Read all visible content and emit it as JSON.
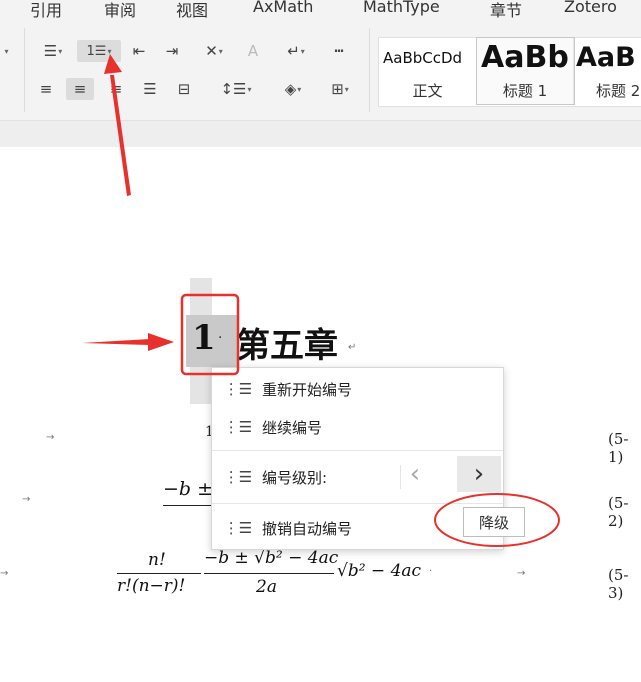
{
  "menu": [
    "引用",
    "审阅",
    "视图",
    "AxMath",
    "MathType",
    "章节",
    "Zotero"
  ],
  "ribbon": {
    "row1_icons": [
      "bullet-list-icon",
      "numbered-list-icon",
      "decrease-indent-icon",
      "increase-indent-icon",
      "chinese-layout-icon",
      "text-direction-icon",
      "line-break-icon",
      "ruler-icon"
    ],
    "row2_icons": [
      "align-left-icon",
      "align-center-icon",
      "align-right-icon",
      "justify-icon",
      "distributed-icon",
      "line-spacing-icon",
      "shading-icon",
      "borders-icon"
    ],
    "styles": [
      {
        "sample": "AaBbCcDd",
        "name": "正文"
      },
      {
        "sample": "AaBb",
        "name": "标题 1"
      },
      {
        "sample": "AaB",
        "name": "标题 2"
      }
    ]
  },
  "document": {
    "heading_number": "1",
    "heading_dot": "·",
    "heading_text": "第五章",
    "para_mark": "↵",
    "tab_mark": "→",
    "eq_labels": [
      "(5-1)",
      "(5-2)",
      "(5-3)"
    ],
    "eq2_partial": "−b ± √",
    "eq3": {
      "frac1_num": "n!",
      "frac1_den": "r!(n−r)!",
      "frac2_num": "−b ± √b² − 4ac",
      "frac2_den": "2a",
      "tail": "√b² − 4ac"
    }
  },
  "context_menu": {
    "items": [
      {
        "label": "重新开始编号",
        "icon": "restart-numbering-icon"
      },
      {
        "label": "继续编号",
        "icon": "continue-numbering-icon"
      },
      {
        "label": "编号级别:",
        "icon": "numbering-level-icon"
      },
      {
        "label": "撤销自动编号",
        "icon": "undo-auto-numbering-icon"
      }
    ],
    "prev_glyph": "‹",
    "next_glyph": "›",
    "tooltip": "降级"
  },
  "colors": {
    "annotation_red": "#e8312c",
    "ribbon_bg": "#f3f3f3",
    "highlight": "#dcdcdc"
  }
}
